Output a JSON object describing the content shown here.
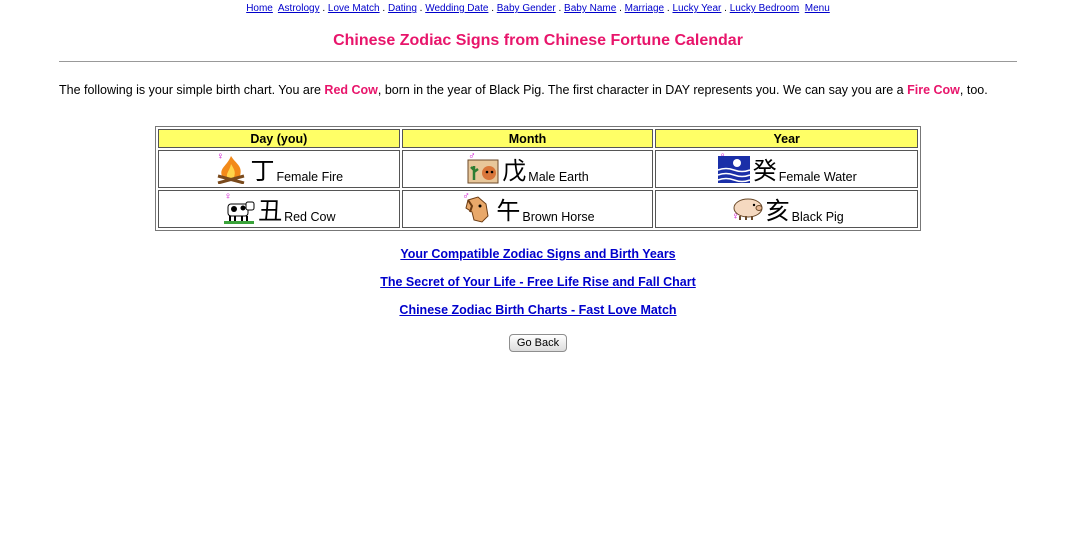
{
  "nav": {
    "items": [
      "Home",
      "Astrology",
      "Love Match",
      "Dating",
      "Wedding Date",
      "Baby Gender",
      "Baby Name",
      "Marriage",
      "Lucky Year",
      "Lucky Bedroom",
      "Menu"
    ],
    "separator": "."
  },
  "page_title": "Chinese Zodiac Signs from Chinese Fortune Calendar",
  "intro": {
    "part1": "The following is your simple birth chart. You are ",
    "highlight1": "Red Cow",
    "part2": ", born in the year of Black Pig. The first character in DAY represents you. We can say you are a ",
    "highlight2": "Fire Cow",
    "part3": ", too."
  },
  "chart": {
    "headers": [
      "Day (you)",
      "Month",
      "Year"
    ],
    "rows": [
      [
        {
          "icon": "fire-icon",
          "gender": "♀",
          "char": "丁",
          "label": "Female Fire"
        },
        {
          "icon": "earth-icon",
          "gender": "♂",
          "char": "戊",
          "label": "Male Earth"
        },
        {
          "icon": "water-icon",
          "gender": "♀",
          "char": "癸",
          "label": "Female Water"
        }
      ],
      [
        {
          "icon": "cow-icon",
          "gender": "♀",
          "char": "丑",
          "label": "Red Cow"
        },
        {
          "icon": "horse-icon",
          "gender": "♂",
          "char": "午",
          "label": "Brown Horse"
        },
        {
          "icon": "pig-icon",
          "gender": "♀",
          "char": "亥",
          "label": "Black Pig"
        }
      ]
    ],
    "colors": {
      "header_bg": "#ffff66",
      "highlight": "#e8156b",
      "link": "#0000cc"
    }
  },
  "links": [
    "Your Compatible Zodiac Signs and Birth Years",
    "The Secret of Your Life - Free Life Rise and Fall Chart",
    "Chinese Zodiac Birth Charts - Fast Love Match"
  ],
  "go_back_label": "Go Back"
}
